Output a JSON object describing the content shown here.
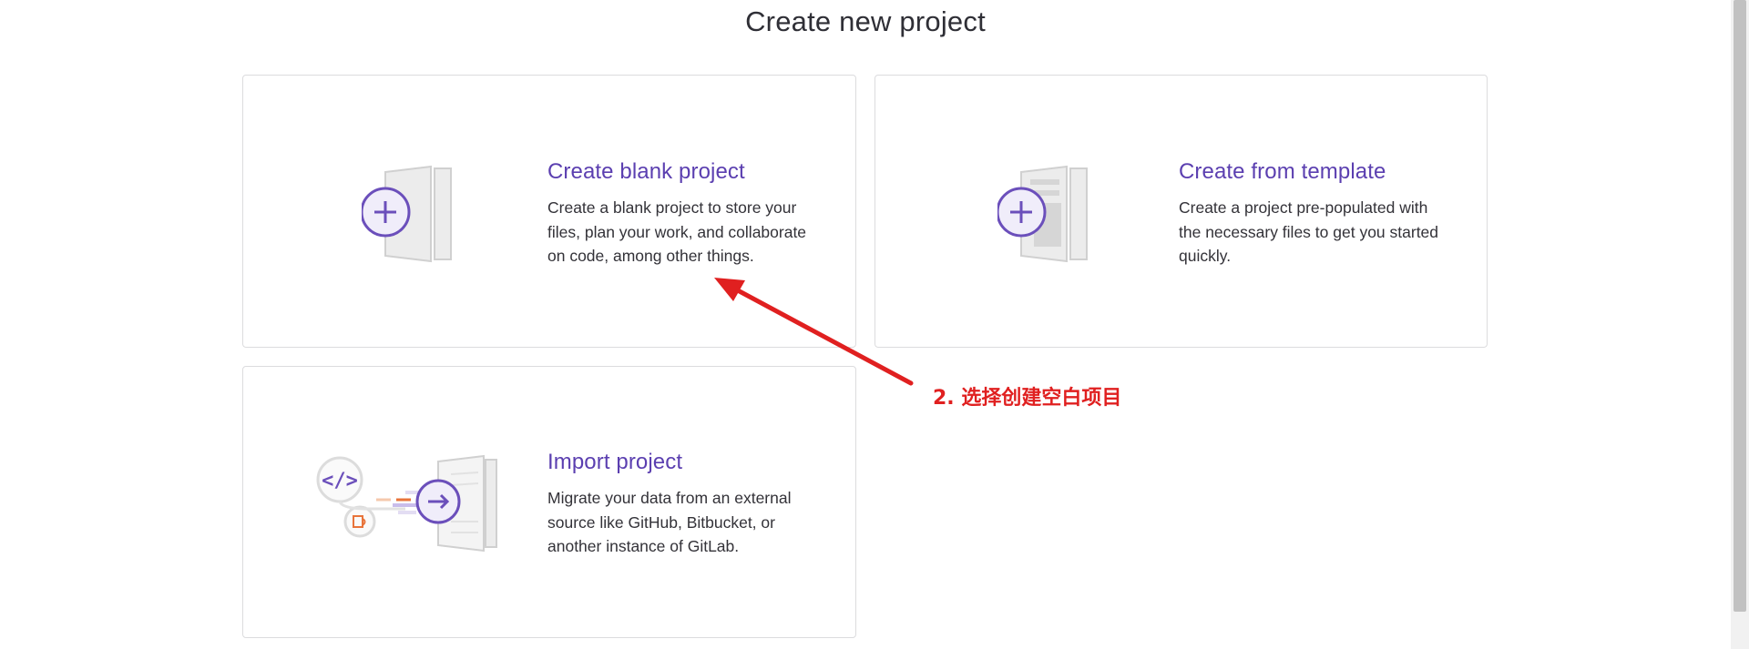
{
  "page": {
    "title": "Create new project"
  },
  "cards": [
    {
      "id": "blank",
      "title": "Create blank project",
      "description": "Create a blank project to store your files, plan your work, and collaborate on code, among other things.",
      "icon": "blank-project-icon"
    },
    {
      "id": "template",
      "title": "Create from template",
      "description": "Create a project pre-populated with the necessary files to get you started quickly.",
      "icon": "template-project-icon"
    },
    {
      "id": "import",
      "title": "Import project",
      "description": "Migrate your data from an external source like GitHub, Bitbucket, or another instance of GitLab.",
      "icon": "import-project-icon"
    }
  ],
  "annotation": {
    "text": "2. 选择创建空白项目",
    "color": "#e02020"
  },
  "colors": {
    "accent": "#5b3fb0",
    "border": "#dcdcde"
  }
}
